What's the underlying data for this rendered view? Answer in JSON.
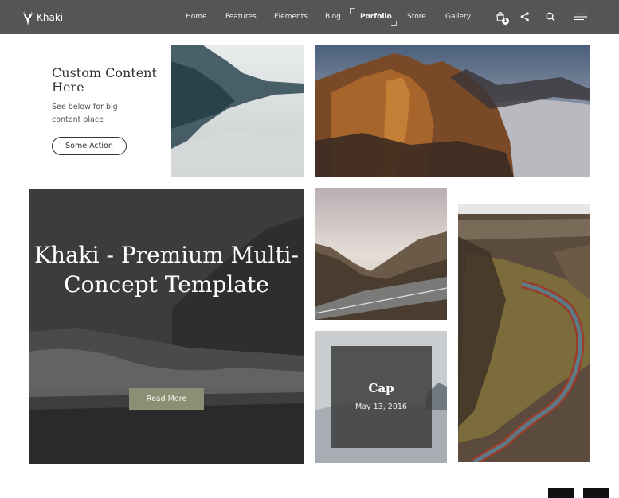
{
  "nav": {
    "brand": "Khaki",
    "items": [
      {
        "label": "Home"
      },
      {
        "label": "Features"
      },
      {
        "label": "Elements"
      },
      {
        "label": "Blog"
      },
      {
        "label": "Porfolio",
        "active": true
      },
      {
        "label": "Store"
      },
      {
        "label": "Gallery"
      }
    ],
    "cart_count": "1",
    "icons": [
      "cart-icon",
      "share-icon",
      "search-icon",
      "hamburger-menu-icon"
    ]
  },
  "intro": {
    "title": "Custom Content Here",
    "text": "See below for big content place",
    "action_label": "Some Action"
  },
  "hero": {
    "title": "Khaki - Premium Multi-Concept Template",
    "button_label": "Read More"
  },
  "caption_tile": {
    "title": "Cap",
    "date": "May 13, 2016"
  },
  "colors": {
    "nav_bg": "#555555",
    "accent_button": "#8b8f73",
    "dark_overlay": "#3c3c3c"
  }
}
